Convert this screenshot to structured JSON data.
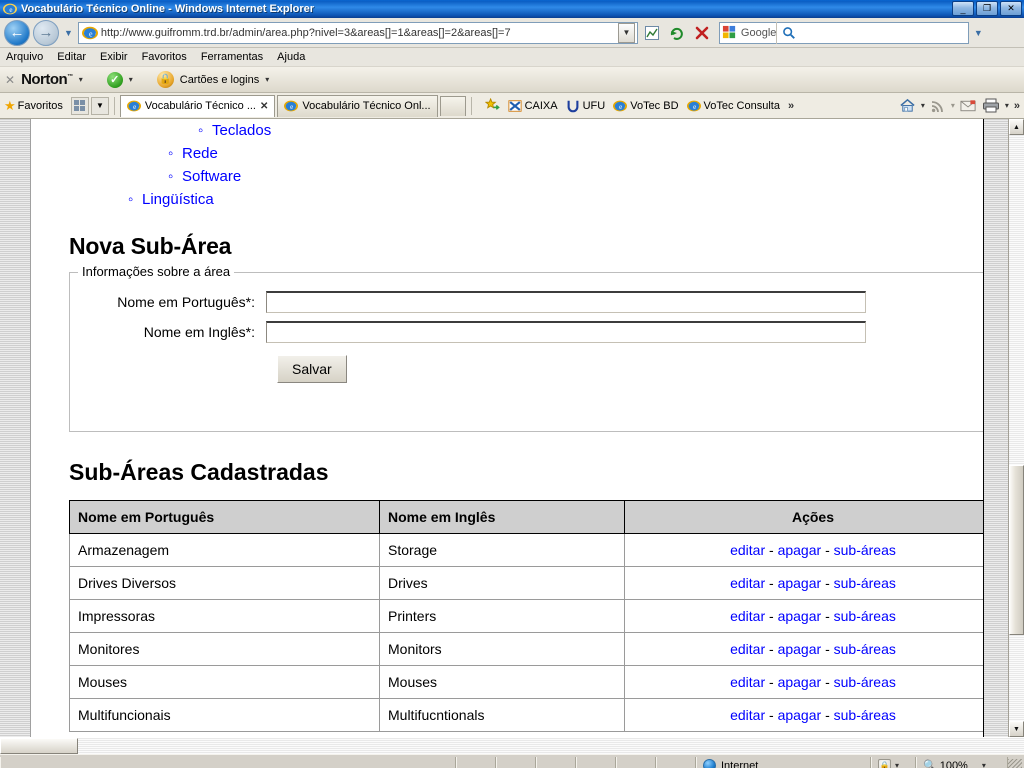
{
  "window": {
    "title": "Vocabulário Técnico Online - Windows Internet Explorer",
    "minimize_label": "_",
    "restore_label": "❐",
    "close_label": "✕"
  },
  "address_bar": {
    "url": "http://www.guifromm.trd.br/admin/area.php?nivel=3&areas[]=1&areas[]=2&areas[]=7",
    "dropdown_icon": "chevron-down-icon",
    "back_icon": "back-arrow-icon",
    "forward_icon": "forward-arrow-icon",
    "compat_icon": "compatibility-view-icon",
    "refresh_icon": "refresh-icon",
    "stop_icon": "stop-icon"
  },
  "search": {
    "placeholder": "Google",
    "provider_icon": "google-icon",
    "go_icon": "search-icon",
    "dropdown_icon": "chevron-down-icon"
  },
  "menu": {
    "items": [
      "Arquivo",
      "Editar",
      "Exibir",
      "Favoritos",
      "Ferramentas",
      "Ajuda"
    ]
  },
  "norton_bar": {
    "close_label": "✕",
    "brand": "Norton",
    "trademark": "™",
    "status_icon": "green-check-icon",
    "cards_icon": "lock-icon",
    "cards_label": "Cartões e logins",
    "caret": "▾"
  },
  "favbar": {
    "star_icon": "star-icon",
    "favorites_label": "Favoritos",
    "grid_icon": "grid-icon",
    "dropdown_icon": "chevron-down-icon",
    "add_favorite_icon": "add-favorite-icon",
    "links": [
      {
        "label": "CAIXA",
        "icon": "caixa-icon"
      },
      {
        "label": "UFU",
        "icon": "ufu-icon"
      },
      {
        "label": "VoTec BD",
        "icon": "ie-icon"
      },
      {
        "label": "VoTec Consulta",
        "icon": "ie-icon"
      }
    ],
    "overflow": "»",
    "right_icons": [
      {
        "name": "home-icon",
        "caret": "▾"
      },
      {
        "name": "rss-icon",
        "caret": "▾"
      },
      {
        "name": "mail-icon",
        "caret": ""
      },
      {
        "name": "print-icon",
        "caret": "▾"
      }
    ],
    "right_overflow": "»"
  },
  "tabs": [
    {
      "label": "Vocabulário Técnico ...",
      "icon": "ie-icon",
      "close": "✕",
      "active": true
    },
    {
      "label": "Vocabulário Técnico Onl...",
      "icon": "ie-icon",
      "close": "",
      "active": false
    }
  ],
  "page": {
    "breadcrumb_list": [
      {
        "label": "Teclados",
        "level": 3
      },
      {
        "label": "Rede",
        "level": 2
      },
      {
        "label": "Software",
        "level": 2
      },
      {
        "label": "Lingüística",
        "level": 1
      }
    ],
    "new_subarea_title": "Nova Sub-Área",
    "form": {
      "legend": "Informações sobre a área",
      "fields": [
        {
          "label": "Nome em Português*:",
          "value": "",
          "placeholder": ""
        },
        {
          "label": "Nome em Inglês*:",
          "value": "",
          "placeholder": ""
        }
      ],
      "submit_label": "Salvar"
    },
    "table_title": "Sub-Áreas Cadastradas",
    "table": {
      "headers": [
        "Nome em Português",
        "Nome em Inglês",
        "Ações"
      ],
      "actions": {
        "edit": "editar",
        "delete": "apagar",
        "subareas": "sub-áreas",
        "separator": "-"
      },
      "rows": [
        {
          "pt": "Armazenagem",
          "en": "Storage"
        },
        {
          "pt": "Drives Diversos",
          "en": "Drives"
        },
        {
          "pt": "Impressoras",
          "en": "Printers"
        },
        {
          "pt": "Monitores",
          "en": "Monitors"
        },
        {
          "pt": "Mouses",
          "en": "Mouses"
        },
        {
          "pt": "Multifuncionais",
          "en": "Multifucntionals"
        }
      ]
    }
  },
  "scrollbars": {
    "up_arrow": "▲",
    "down_arrow": "▼",
    "left_arrow": "◄",
    "right_arrow": "►"
  },
  "status_bar": {
    "zone_icon": "internet-zone-icon",
    "zone_label": "Internet",
    "protected_icon": "protected-mode-icon",
    "protected_caret": "▾",
    "zoom_icon": "zoom-icon",
    "zoom_level": "100%",
    "zoom_caret": "▾"
  },
  "colors": {
    "link": "#0000ff",
    "title_bar": "#0a5fc4",
    "table_header": "#cfcfcf"
  }
}
